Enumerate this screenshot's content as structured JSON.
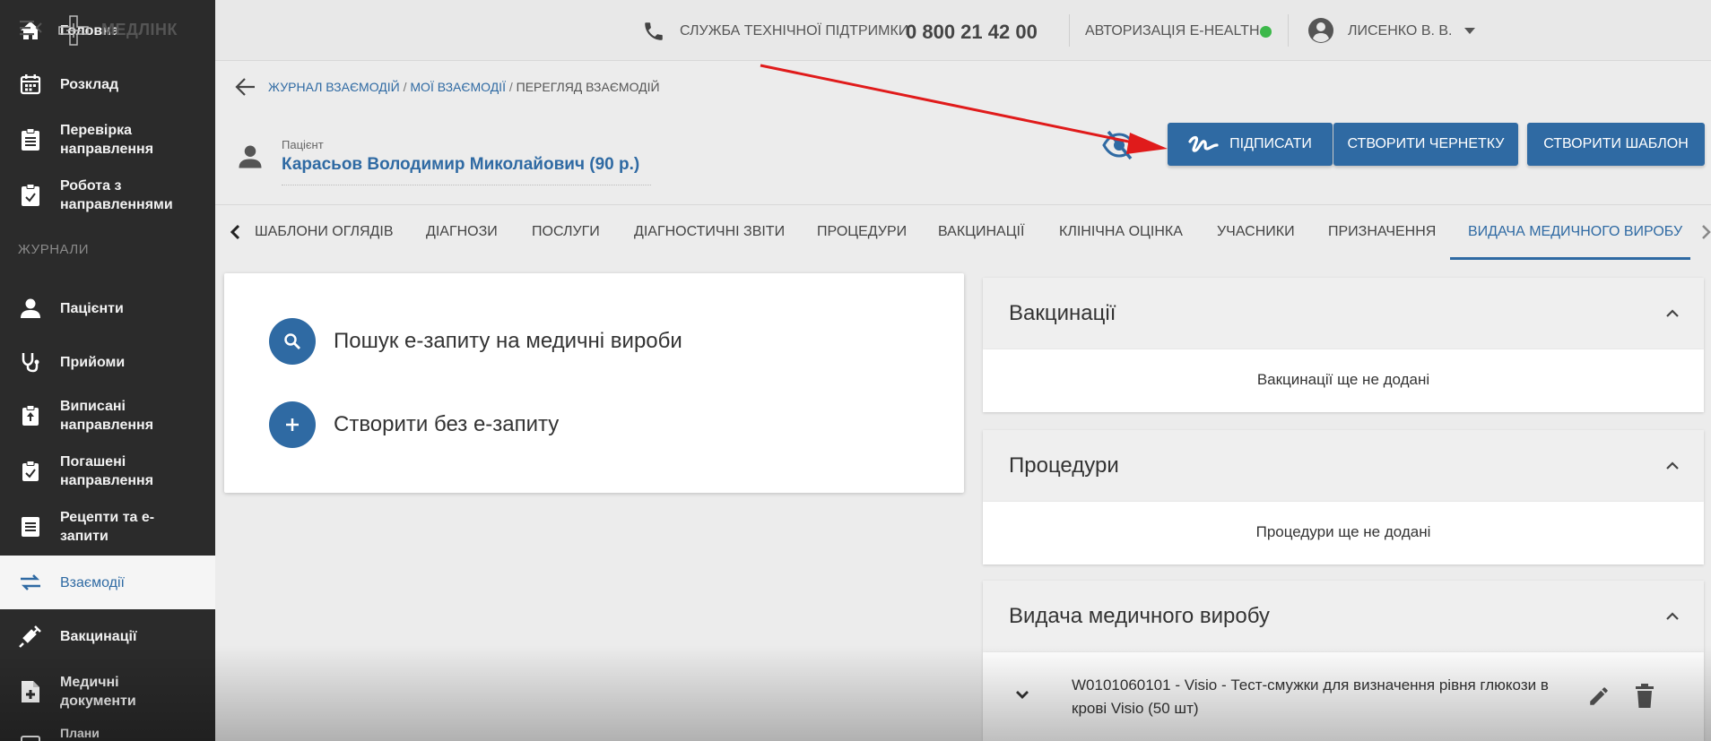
{
  "sidebar": {
    "items": [
      {
        "label": "Головна",
        "icon": "home-icon"
      },
      {
        "label": "Розклад",
        "icon": "calendar-icon"
      },
      {
        "label": "Перевірка\nнаправлення",
        "icon": "clipboard-list-icon"
      },
      {
        "label": "Робота з\nнаправленнями",
        "icon": "clipboard-icon"
      }
    ],
    "section_label": "ЖУРНАЛИ",
    "journal_items": [
      {
        "label": "Пацієнти",
        "icon": "person-icon"
      },
      {
        "label": "Прийоми",
        "icon": "stethoscope-icon"
      },
      {
        "label": "Виписані\nнаправлення",
        "icon": "clipboard-up-icon"
      },
      {
        "label": "Погашені\nнаправлення",
        "icon": "clipboard-check-icon"
      },
      {
        "label": "Рецепти та е-\nзапити",
        "icon": "list-icon"
      },
      {
        "label": "Взаємодії",
        "icon": "swap-icon",
        "active": true
      },
      {
        "label": "Вакцинації",
        "icon": "syringe-icon"
      },
      {
        "label": "Медичні\nдокументи",
        "icon": "document-plus-icon"
      },
      {
        "label": "Плани",
        "icon": "plans-icon"
      }
    ]
  },
  "header": {
    "app_title": "МЕДЛІНК",
    "support_label": "СЛУЖБА ТЕХНІЧНОЇ ПІДТРИМКИ",
    "support_phone": "0 800 21 42 00",
    "ehealth_label": "АВТОРИЗАЦІЯ E-HEALTH",
    "ehealth_status_color": "#3cb84a",
    "user_name": "ЛИСЕНКО В. В."
  },
  "breadcrumb": {
    "items": [
      "ЖУРНАЛ ВЗАЄМОДІЙ",
      "МОЇ ВЗАЄМОДІЇ"
    ],
    "current": "ПЕРЕГЛЯД ВЗАЄМОДІЙ",
    "separator": "/"
  },
  "patient": {
    "caption": "Пацієнт",
    "name": "Карасьов Володимир Миколайович (90 р.)"
  },
  "actions": {
    "sign": "ПІДПИСАТИ",
    "draft": "СТВОРИТИ ЧЕРНЕТКУ",
    "template": "СТВОРИТИ ШАБЛОН"
  },
  "tabs": [
    {
      "label": "ШАБЛОНИ ОГЛЯДІВ"
    },
    {
      "label": "ДІАГНОЗИ"
    },
    {
      "label": "ПОСЛУГИ"
    },
    {
      "label": "ДІАГНОСТИЧНІ ЗВІТИ"
    },
    {
      "label": "ПРОЦЕДУРИ"
    },
    {
      "label": "ВАКЦИНАЦІЇ"
    },
    {
      "label": "КЛІНІЧНА ОЦІНКА"
    },
    {
      "label": "УЧАСНИКИ"
    },
    {
      "label": "ПРИЗНАЧЕННЯ"
    },
    {
      "label": "ВИДАЧА МЕДИЧНОГО ВИРОБУ",
      "active": true
    }
  ],
  "left_card": {
    "search_label": "Пошук е-запиту на медичні вироби",
    "create_label": "Створити без е-запиту"
  },
  "panels": {
    "vaccinations": {
      "title": "Вакцинації",
      "empty": "Вакцинації ще не додані"
    },
    "procedures": {
      "title": "Процедури",
      "empty": "Процедури ще не додані"
    },
    "device": {
      "title": "Видача медичного виробу",
      "item": "W0101060101 - Visio - Тест-смужки для визначення рівня глюкози в крові Visio (50 шт)"
    }
  },
  "colors": {
    "primary": "#2f6aa3",
    "sidebar_bg": "#2b2b2b",
    "annotation_arrow": "#e01b1b"
  }
}
